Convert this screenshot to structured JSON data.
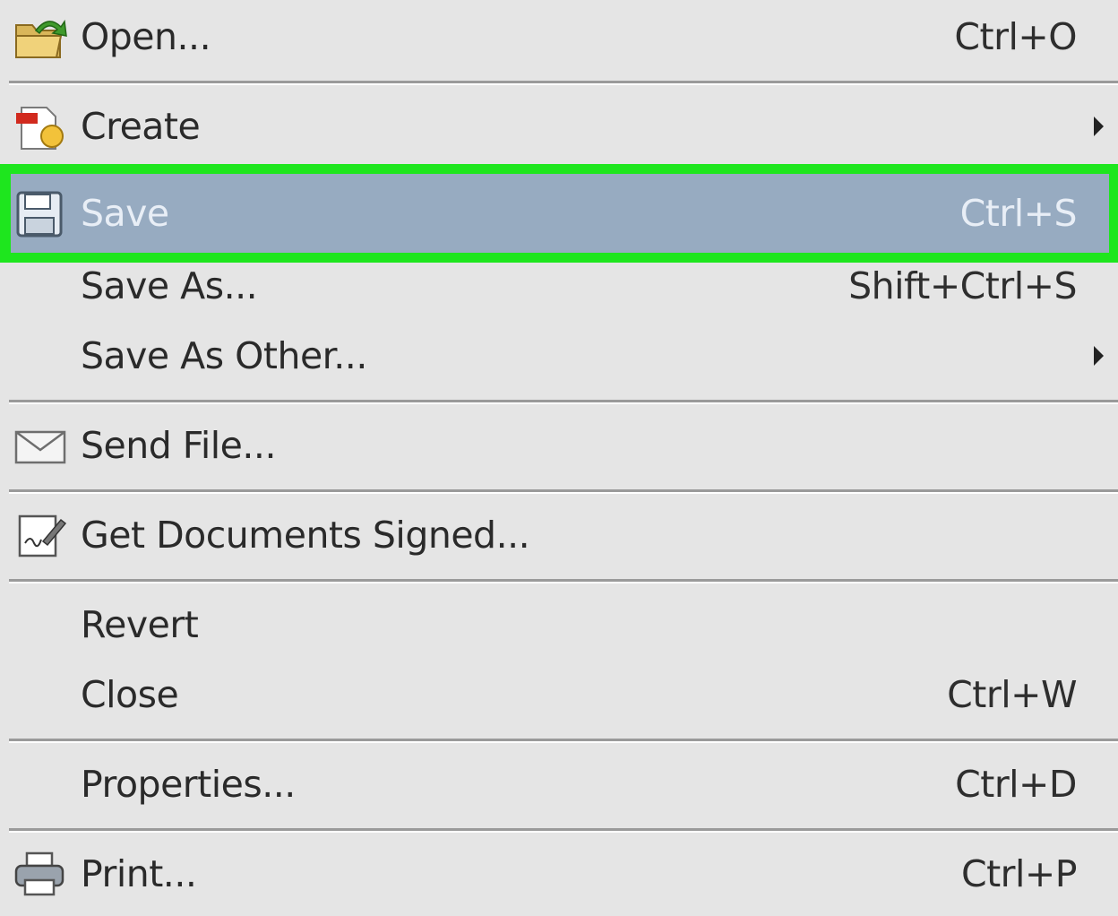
{
  "menu": {
    "items": [
      {
        "label": "Open...",
        "shortcut": "Ctrl+O",
        "icon": "open-folder-icon"
      },
      {
        "label": "Create",
        "shortcut": "",
        "icon": "create-pdf-icon",
        "submenu": true
      },
      {
        "label": "Save",
        "shortcut": "Ctrl+S",
        "icon": "floppy-disk-icon",
        "selected": true
      },
      {
        "label": "Save As...",
        "shortcut": "Shift+Ctrl+S"
      },
      {
        "label": "Save As Other...",
        "shortcut": "",
        "submenu": true
      },
      {
        "label": "Send File...",
        "shortcut": "",
        "icon": "envelope-icon"
      },
      {
        "label": "Get Documents Signed...",
        "shortcut": "",
        "icon": "sign-document-icon"
      },
      {
        "label": "Revert",
        "shortcut": ""
      },
      {
        "label": "Close",
        "shortcut": "Ctrl+W"
      },
      {
        "label": "Properties...",
        "shortcut": "Ctrl+D"
      },
      {
        "label": "Print...",
        "shortcut": "Ctrl+P",
        "icon": "printer-icon"
      }
    ],
    "highlight_color": "#1ee61e",
    "selection_color": "#97abc1"
  }
}
